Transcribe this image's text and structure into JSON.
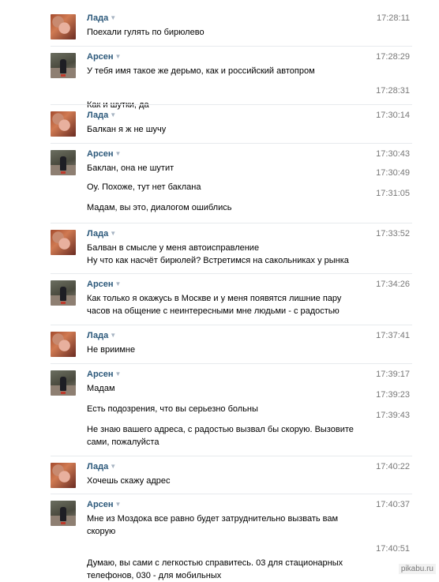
{
  "messages": [
    {
      "author": "Лада",
      "avatar": "lada",
      "entries": [
        {
          "time": "17:28:11",
          "lines": [
            "Поехали гулять по бирюлево"
          ]
        }
      ]
    },
    {
      "author": "Арсен",
      "avatar": "arsen",
      "entries": [
        {
          "time": "17:28:29",
          "lines": [
            "У тебя имя такое же дерьмо, как и российский автопром"
          ]
        },
        {
          "time": "17:28:31",
          "lines": [
            "Как и шутки, да"
          ]
        }
      ]
    },
    {
      "author": "Лада",
      "avatar": "lada",
      "entries": [
        {
          "time": "17:30:14",
          "lines": [
            "Балкан я ж не шучу"
          ]
        }
      ]
    },
    {
      "author": "Арсен",
      "avatar": "arsen",
      "entries": [
        {
          "time": "17:30:43",
          "lines": [
            "Баклан, она не шутит"
          ]
        },
        {
          "time": "17:30:49",
          "lines": [
            "Оу. Похоже, тут нет баклана"
          ]
        },
        {
          "time": "17:31:05",
          "lines": [
            "Мадам, вы это, диалогом ошиблись"
          ]
        }
      ]
    },
    {
      "author": "Лада",
      "avatar": "lada",
      "entries": [
        {
          "time": "17:33:52",
          "lines": [
            "Балван в смысле у меня автоисправление",
            "Ну что как насчёт бирюлей? Встретимся на сакольниках у рынка"
          ]
        }
      ]
    },
    {
      "author": "Арсен",
      "avatar": "arsen",
      "entries": [
        {
          "time": "17:34:26",
          "lines": [
            "Как только я окажусь в Москве и у меня появятся лишние пару",
            "часов на общение с неинтересными мне людьми - с радостью"
          ]
        }
      ]
    },
    {
      "author": "Лада",
      "avatar": "lada",
      "entries": [
        {
          "time": "17:37:41",
          "lines": [
            "Не вриимне"
          ]
        }
      ]
    },
    {
      "author": "Арсен",
      "avatar": "arsen",
      "entries": [
        {
          "time": "17:39:17",
          "lines": [
            "Мадам"
          ]
        },
        {
          "time": "17:39:23",
          "lines": [
            "Есть подозрения, что вы серьезно больны"
          ]
        },
        {
          "time": "17:39:43",
          "lines": [
            "Не знаю вашего адреса, с радостью вызвал бы скорую. Вызовите",
            "сами, пожалуйста"
          ]
        }
      ]
    },
    {
      "author": "Лада",
      "avatar": "lada",
      "entries": [
        {
          "time": "17:40:22",
          "lines": [
            "Хочешь скажу адрес"
          ]
        }
      ]
    },
    {
      "author": "Арсен",
      "avatar": "arsen",
      "entries": [
        {
          "time": "17:40:37",
          "lines": [
            "Мне из Моздока все равно будет затруднительно вызвать вам",
            "скорую"
          ]
        },
        {
          "time": "17:40:51",
          "lines": [
            "Думаю, вы сами с легкостью справитесь. 03 для стационарных",
            "телефонов, 030 - для мобильных"
          ]
        }
      ]
    }
  ],
  "caret_glyph": "▼",
  "watermark": "pikabu.ru"
}
